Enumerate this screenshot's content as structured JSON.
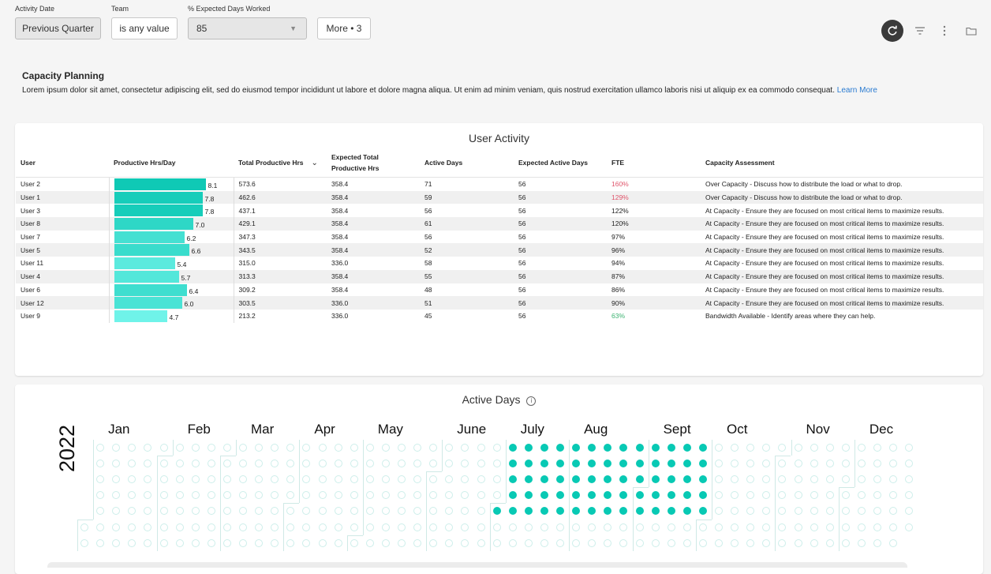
{
  "filters": [
    {
      "label": "Activity Date",
      "value": "Previous Quarter"
    },
    {
      "label": "Team",
      "value": "is any value"
    },
    {
      "label": "% Expected Days Worked",
      "value": "85"
    }
  ],
  "more_label": "More • 3",
  "toolbar_icons": [
    "refresh-icon",
    "filter-icon",
    "more-vert-icon",
    "folder-icon"
  ],
  "intro": {
    "title": "Capacity Planning",
    "text": "Lorem ipsum dolor sit amet, consectetur adipiscing elit, sed do eiusmod tempor incididunt ut labore et dolore magna aliqua. Ut enim ad minim veniam, quis nostrud exercitation ullamco laboris nisi ut aliquip ex ea commodo consequat.",
    "link": "Learn More"
  },
  "user_activity": {
    "title": "User Activity",
    "columns": [
      "User",
      "Productive Hrs/Day",
      "Total Productive Hrs",
      "Expected Total Productive Hrs",
      "Active Days",
      "Expected Active Days",
      "FTE",
      "Capacity Assessment"
    ],
    "sort_indicator": "⌄",
    "rows": [
      {
        "user": "User 2",
        "hrs_day": "8.1",
        "total": "573.6",
        "expected": "358.4",
        "active": "71",
        "exp_active": "56",
        "fte": "160%",
        "status": "over",
        "assessment": "Over Capacity - Discuss how to distribute the load or what to drop."
      },
      {
        "user": "User 1",
        "hrs_day": "7.8",
        "total": "462.6",
        "expected": "358.4",
        "active": "59",
        "exp_active": "56",
        "fte": "129%",
        "status": "over",
        "assessment": "Over Capacity - Discuss how to distribute the load or what to drop."
      },
      {
        "user": "User 3",
        "hrs_day": "7.8",
        "total": "437.1",
        "expected": "358.4",
        "active": "56",
        "exp_active": "56",
        "fte": "122%",
        "status": "at",
        "assessment": "At Capacity - Ensure they are focused on most critical items to maximize results."
      },
      {
        "user": "User 8",
        "hrs_day": "7.0",
        "total": "429.1",
        "expected": "358.4",
        "active": "61",
        "exp_active": "56",
        "fte": "120%",
        "status": "at",
        "assessment": "At Capacity - Ensure they are focused on most critical items to maximize results."
      },
      {
        "user": "User 7",
        "hrs_day": "6.2",
        "total": "347.3",
        "expected": "358.4",
        "active": "56",
        "exp_active": "56",
        "fte": "97%",
        "status": "at",
        "assessment": "At Capacity - Ensure they are focused on most critical items to maximize results."
      },
      {
        "user": "User 5",
        "hrs_day": "6.6",
        "total": "343.5",
        "expected": "358.4",
        "active": "52",
        "exp_active": "56",
        "fte": "96%",
        "status": "at",
        "assessment": "At Capacity - Ensure they are focused on most critical items to maximize results."
      },
      {
        "user": "User 11",
        "hrs_day": "5.4",
        "total": "315.0",
        "expected": "336.0",
        "active": "58",
        "exp_active": "56",
        "fte": "94%",
        "status": "at",
        "assessment": "At Capacity - Ensure they are focused on most critical items to maximize results."
      },
      {
        "user": "User 4",
        "hrs_day": "5.7",
        "total": "313.3",
        "expected": "358.4",
        "active": "55",
        "exp_active": "56",
        "fte": "87%",
        "status": "at",
        "assessment": "At Capacity - Ensure they are focused on most critical items to maximize results."
      },
      {
        "user": "User 6",
        "hrs_day": "6.4",
        "total": "309.2",
        "expected": "358.4",
        "active": "48",
        "exp_active": "56",
        "fte": "86%",
        "status": "at",
        "assessment": "At Capacity - Ensure they are focused on most critical items to maximize results."
      },
      {
        "user": "User 12",
        "hrs_day": "6.0",
        "total": "303.5",
        "expected": "336.0",
        "active": "51",
        "exp_active": "56",
        "fte": "90%",
        "status": "at",
        "assessment": "At Capacity - Ensure they are focused on most critical items to maximize results."
      },
      {
        "user": "User 9",
        "hrs_day": "4.7",
        "total": "213.2",
        "expected": "336.0",
        "active": "45",
        "exp_active": "56",
        "fte": "63%",
        "status": "under",
        "assessment": "Bandwidth Available - Identify areas where they can help."
      }
    ],
    "colors": {
      "over": "#e0556b",
      "at": "#222222",
      "under": "#3cb371",
      "bar_dark": "#0fc9b5",
      "bar_light": "#6ff3e9"
    }
  },
  "active_days": {
    "title": "Active Days",
    "info_icon": "info-icon",
    "year": "2022",
    "months": [
      "Jan",
      "Feb",
      "Mar",
      "Apr",
      "May",
      "June",
      "July",
      "Aug",
      "Sept",
      "Oct",
      "Nov",
      "Dec"
    ],
    "active_dates": {
      "July": [
        1,
        4,
        5,
        6,
        7,
        8,
        11,
        12,
        13,
        14,
        15,
        18,
        19,
        20,
        21,
        22,
        25,
        26,
        27,
        28,
        29
      ],
      "Aug": [
        1,
        2,
        3,
        4,
        5,
        8,
        9,
        10,
        11,
        12,
        15,
        16,
        17,
        18,
        19,
        22,
        23,
        24,
        25,
        26,
        29,
        30,
        31
      ],
      "Sept": [
        1,
        2,
        5,
        6,
        7,
        8,
        9,
        12,
        13,
        14,
        15,
        16,
        19,
        20,
        21,
        22,
        23,
        26,
        27,
        28,
        29,
        30
      ]
    },
    "active_color": "#08c9b4"
  }
}
